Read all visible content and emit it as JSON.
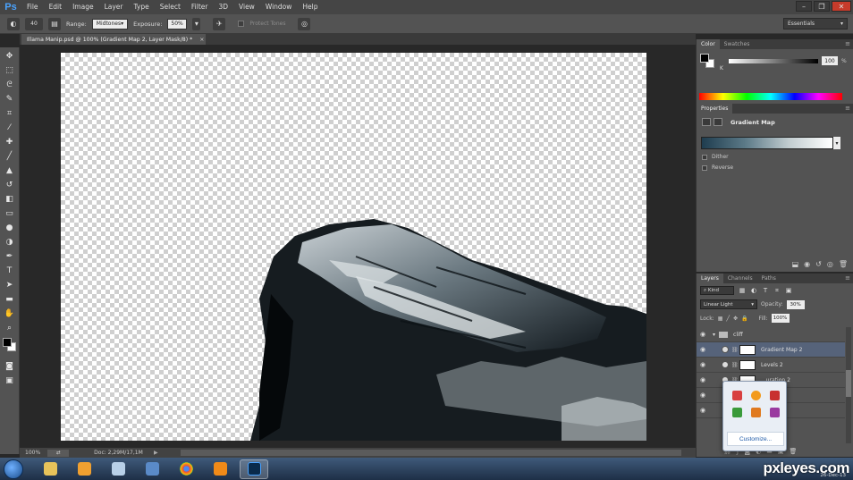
{
  "app": {
    "logo": "Ps",
    "menu": [
      "File",
      "Edit",
      "Image",
      "Layer",
      "Type",
      "Select",
      "Filter",
      "3D",
      "View",
      "Window",
      "Help"
    ],
    "window_controls": [
      "–",
      "❐",
      "✕"
    ]
  },
  "options": {
    "brush_size": "40",
    "range_label": "Range:",
    "range_value": "Midtones",
    "exposure_label": "Exposure:",
    "exposure_value": "50%",
    "protect_tones": "Protect Tones",
    "workspace": "Essentials"
  },
  "document": {
    "tab_title": "Illama Manip.psd @ 100% (Gradient Map 2, Layer Mask/8) *",
    "tab_close": "×",
    "zoom": "100%",
    "doc_size": "Doc: 2,29M/17,1M"
  },
  "color_panel": {
    "tabs": [
      "Color",
      "Swatches"
    ],
    "channel": "K",
    "value": "100",
    "unit": "%"
  },
  "properties": {
    "tab": "Properties",
    "title": "Gradient Map",
    "dither": "Dither",
    "reverse": "Reverse"
  },
  "layers": {
    "tabs": [
      "Layers",
      "Channels",
      "Paths"
    ],
    "kind": "Kind",
    "blend_mode": "Linear Light",
    "opacity_label": "Opacity:",
    "opacity": "30%",
    "lock_label": "Lock:",
    "fill_label": "Fill:",
    "fill": "100%",
    "rows": [
      {
        "name": "cliff",
        "type": "group"
      },
      {
        "name": "Gradient Map 2",
        "type": "adjust",
        "selected": true
      },
      {
        "name": "Levels 2",
        "type": "adjust"
      },
      {
        "name": "...uration 2",
        "type": "adjust"
      }
    ]
  },
  "tray": {
    "customize": "Customize..."
  },
  "watermark": "pxleyes.com",
  "clock": "26-Dec-13",
  "colors": {
    "accent": "#4aa3ff",
    "panel": "#535353",
    "selected_layer": "#56637a"
  }
}
